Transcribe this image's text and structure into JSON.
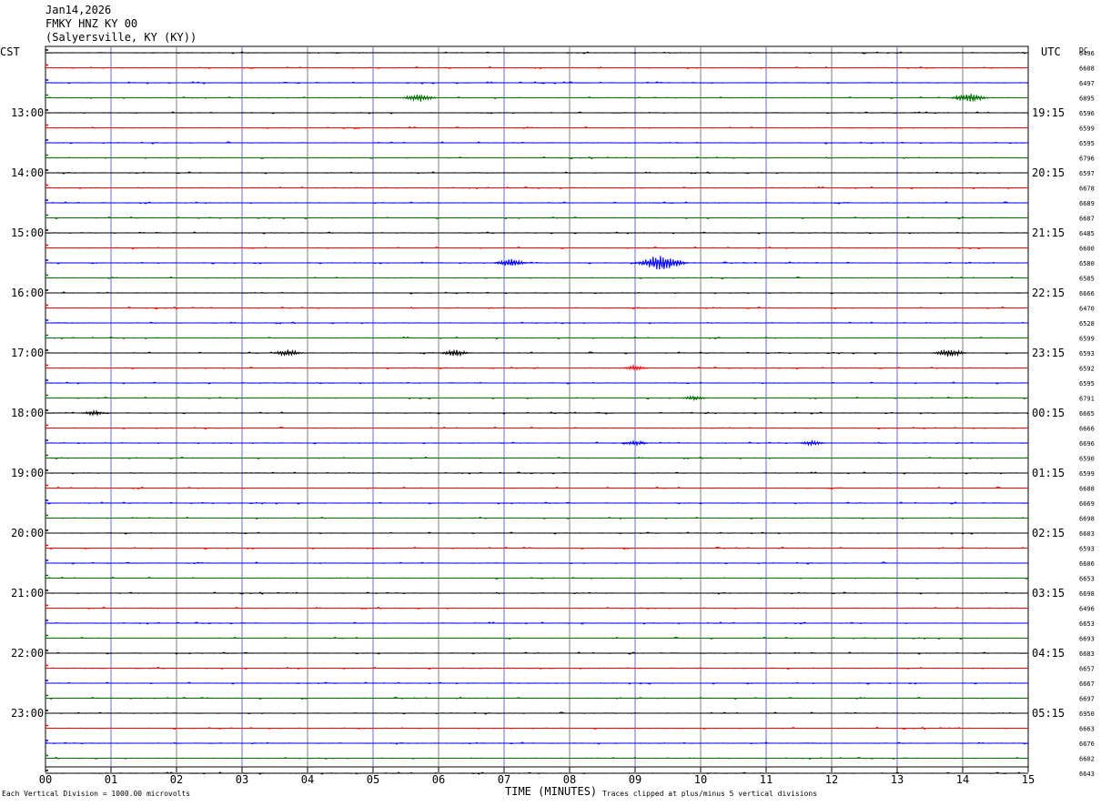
{
  "header": {
    "date": "Jan14,2026",
    "station": "FMKY HNZ KY 00",
    "location": "(Salyersville, KY (KY))"
  },
  "left_label": "CST",
  "right_label": "UTC",
  "dc_label": "DC",
  "footer": {
    "scale": "Each Vertical Division = 1000.00 microvolts",
    "xlabel": "TIME (MINUTES)",
    "clip_note": "Traces clipped at plus/minus 5 vertical divisions"
  },
  "colors": {
    "line1": "#000000",
    "line2": "#ff0000",
    "line3": "#0000ff",
    "line4": "#007000",
    "grid": "#808080"
  },
  "chart_data": {
    "type": "line",
    "xlabel": "TIME (MINUTES)",
    "x_ticks": [
      "00",
      "01",
      "02",
      "03",
      "04",
      "05",
      "06",
      "07",
      "08",
      "09",
      "10",
      "11",
      "12",
      "13",
      "14",
      "15"
    ],
    "xlim": [
      0,
      15
    ],
    "trace_minutes": 15,
    "left_hour_labels": [
      "13:00",
      "14:00",
      "15:00",
      "16:00",
      "17:00",
      "18:00",
      "19:00",
      "20:00",
      "21:00",
      "22:00",
      "23:00"
    ],
    "right_hour_labels": [
      "19:15",
      "20:15",
      "21:15",
      "22:15",
      "23:15",
      "00:15",
      "01:15",
      "02:15",
      "03:15",
      "04:15",
      "05:15"
    ],
    "dc_values": [
      "6496",
      "6608",
      "6497",
      "6895",
      "6596",
      "6599",
      "6595",
      "6796",
      "6597",
      "6678",
      "6689",
      "6687",
      "6485",
      "6600",
      "6580",
      "6585",
      "6666",
      "6470",
      "6528",
      "6599",
      "6593",
      "6592",
      "6595",
      "6791",
      "6665",
      "6666",
      "6696",
      "6590",
      "6599",
      "6688",
      "6669",
      "6698",
      "6603",
      "6593",
      "6606",
      "6653",
      "6698",
      "6496",
      "6653",
      "6693",
      "6683",
      "6657",
      "6667",
      "6697",
      "6950",
      "6663",
      "6676",
      "6602",
      "6643"
    ],
    "events": [
      {
        "trace": 14,
        "minute": 9.4,
        "amplitude": 10
      },
      {
        "trace": 14,
        "minute": 7.1,
        "amplitude": 5
      },
      {
        "trace": 20,
        "minute": 13.8,
        "amplitude": 5
      },
      {
        "trace": 3,
        "minute": 14.1,
        "amplitude": 6
      },
      {
        "trace": 3,
        "minute": 5.7,
        "amplitude": 5
      },
      {
        "trace": 23,
        "minute": 9.9,
        "amplitude": 3
      },
      {
        "trace": 26,
        "minute": 9.0,
        "amplitude": 3
      },
      {
        "trace": 26,
        "minute": 11.7,
        "amplitude": 3
      },
      {
        "trace": 21,
        "minute": 9.0,
        "amplitude": 3
      },
      {
        "trace": 20,
        "minute": 3.7,
        "amplitude": 4
      },
      {
        "trace": 20,
        "minute": 6.25,
        "amplitude": 4
      },
      {
        "trace": 24,
        "minute": 0.75,
        "amplitude": 3
      }
    ]
  }
}
